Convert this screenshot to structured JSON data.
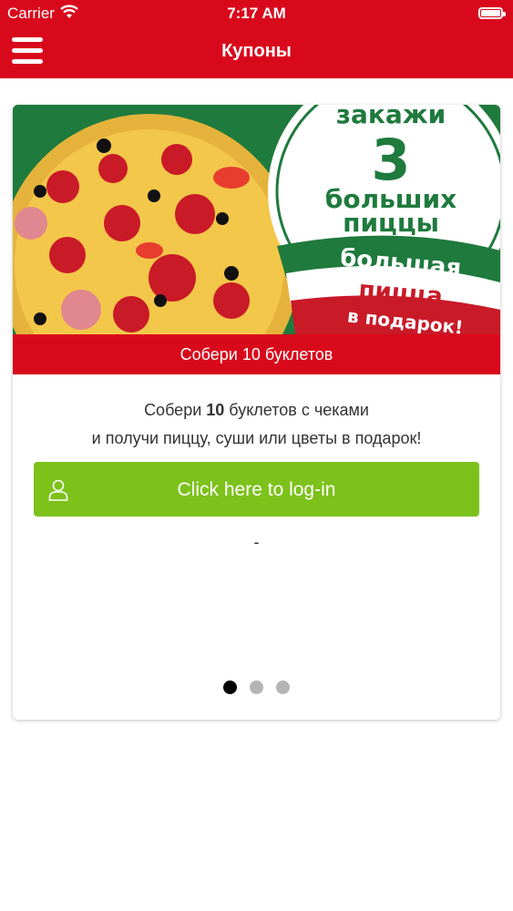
{
  "status_bar": {
    "carrier": "Carrier",
    "time": "7:17 AM"
  },
  "nav": {
    "title": "Купоны"
  },
  "card": {
    "banner": {
      "line1": "закажи",
      "line2": "3",
      "line3": "больших",
      "line4": "пиццы",
      "ribbon1": "большая",
      "ribbon2": "пицца",
      "ribbon3": "в подарок!"
    },
    "header": "Собери 10 буклетов",
    "description_prefix": "Собери ",
    "description_number": "10",
    "description_suffix": " буклетов с чеками",
    "description_line2": "и получи пиццу, суши или цветы в подарок!",
    "login_button": "Click here to log-in",
    "dash": "-",
    "pager": {
      "count": 3,
      "active_index": 1
    }
  },
  "colors": {
    "brand_red": "#d9091c",
    "button_green": "#7dc11b",
    "banner_green": "#1f7a3d"
  }
}
